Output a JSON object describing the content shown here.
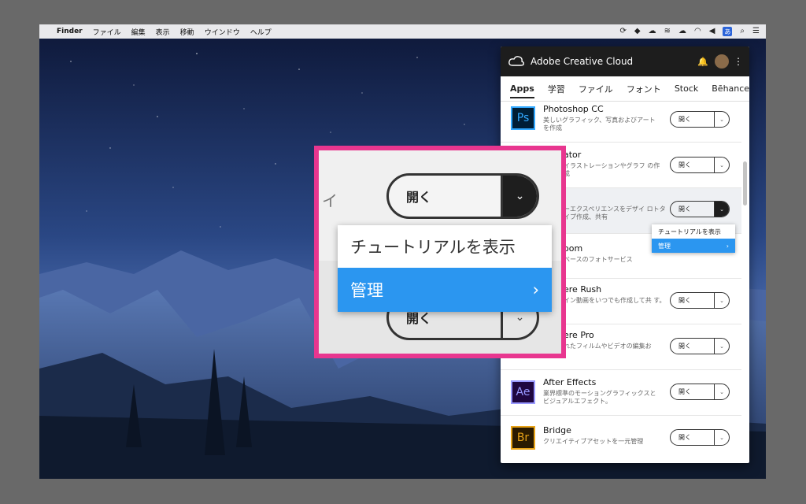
{
  "menubar": {
    "apple_icon": "apple-icon",
    "items": [
      "Finder",
      "ファイル",
      "編集",
      "表示",
      "移動",
      "ウインドウ",
      "ヘルプ"
    ],
    "status_icons": [
      "sync-icon",
      "dropbox-icon",
      "creative-cloud-icon",
      "wifi-tower-icon",
      "cloud-upload-icon",
      "wifi-icon",
      "volume-icon"
    ],
    "ime": "あ"
  },
  "cc": {
    "title": "Adobe Creative Cloud",
    "tabs": [
      "Apps",
      "学習",
      "ファイル",
      "フォント",
      "Stock",
      "Bēhance"
    ],
    "apps": [
      {
        "logo": "Ps",
        "name": "Photoshop CC",
        "desc": "美しいグラフィック、写真およびアートを作成",
        "button": "開く"
      },
      {
        "logo": "",
        "name": "ator",
        "desc": "イラストレーションやグラフ の作成",
        "button": "開く"
      },
      {
        "logo": "",
        "name": "",
        "desc": "ーエクスペリエンスをデザイ ロトタイプ作成、共有",
        "button": "開く"
      },
      {
        "logo": "",
        "name": "oom",
        "desc": "ベースのフォトサービス",
        "button": ""
      },
      {
        "logo": "",
        "name": "ere Rush",
        "desc": "イン動画をいつでも作成して共 す。",
        "button": "開く"
      },
      {
        "logo": "",
        "name": "ere Pro",
        "desc": "れたフィルムやビデオの編集お",
        "button": "開く"
      },
      {
        "logo": "Ae",
        "name": "After Effects",
        "desc": "業界標準のモーショングラフィックスとビジュアルエフェクト。",
        "button": "開く"
      },
      {
        "logo": "Br",
        "name": "Bridge",
        "desc": "クリエイティブアセットを一元管理",
        "button": "開く"
      }
    ],
    "dropdown": {
      "items": [
        "チュートリアルを表示",
        "管理"
      ]
    }
  },
  "zoom": {
    "hint_char": "イ",
    "button_label": "開く",
    "ghost_label": "開く",
    "menu_items": [
      "チュートリアルを表示",
      "管理"
    ]
  },
  "colors": {
    "highlight_border": "#e8368f",
    "selection_blue": "#2b96f0",
    "ps": "#31a8ff",
    "ae": "#9999ff",
    "br": "#e8a317"
  }
}
